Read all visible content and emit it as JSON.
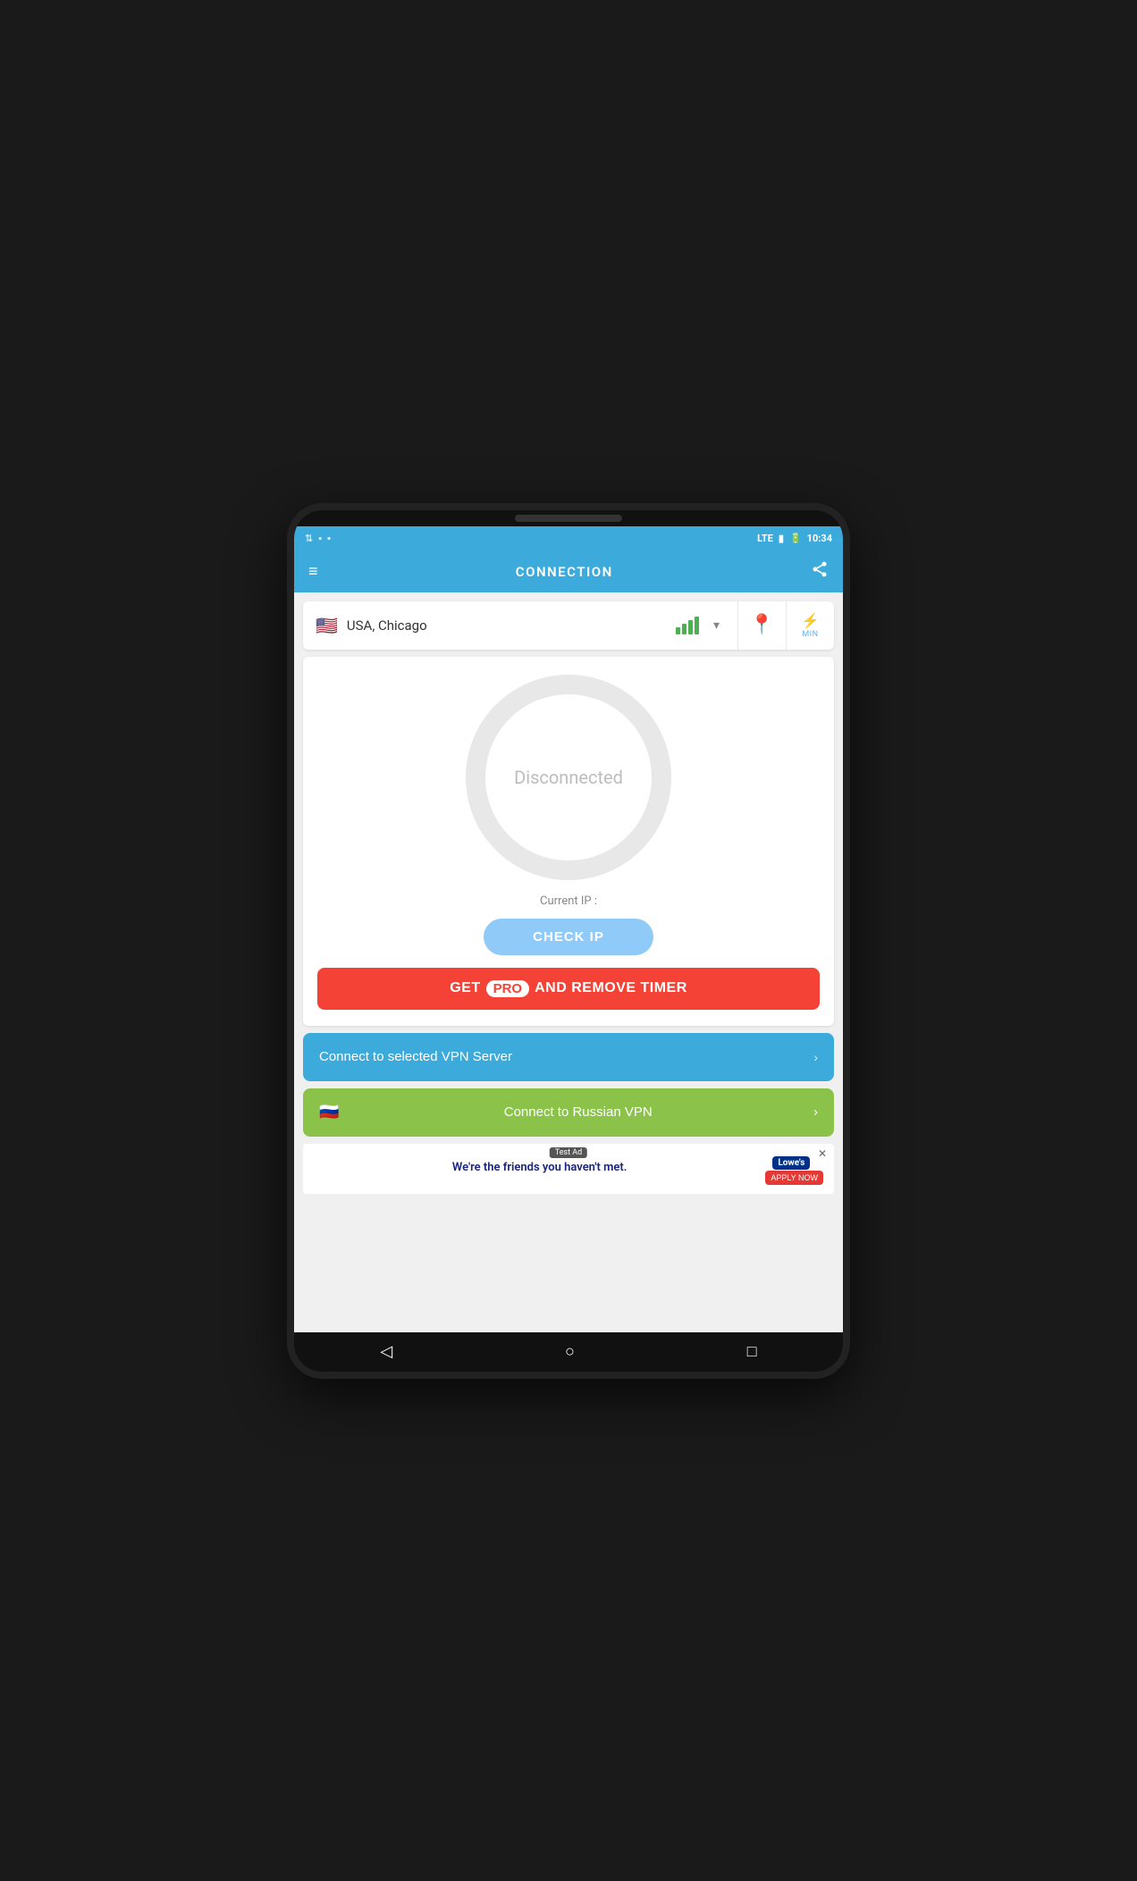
{
  "statusBar": {
    "time": "10:34",
    "networkType": "LTE",
    "batteryIcon": "🔋"
  },
  "header": {
    "title": "CONNECTION",
    "menuIcon": "≡",
    "shareIcon": "⋮"
  },
  "serverSelector": {
    "flag": "🇺🇸",
    "serverName": "USA, Chicago",
    "locationIconColor": "#e53935",
    "minLabel": "MIN"
  },
  "connectionArea": {
    "status": "Disconnected",
    "currentIpLabel": "Current IP :",
    "checkIpButton": "CHECK IP",
    "getProButton": {
      "prefix": "GET ",
      "badge": "PRO",
      "suffix": " AND REMOVE TIMER"
    }
  },
  "buttons": {
    "connectSelected": "Connect to selected VPN Server",
    "connectRussian": "Connect to Russian VPN",
    "russianFlag": "🇷🇺",
    "arrowRight": "›"
  },
  "ad": {
    "text": "We're the friends you haven't met.",
    "label": "Test Ad",
    "brand": "Lowe's",
    "applyNow": "APPLY NOW"
  },
  "bottomNav": {
    "back": "◁",
    "home": "○",
    "recents": "□"
  }
}
